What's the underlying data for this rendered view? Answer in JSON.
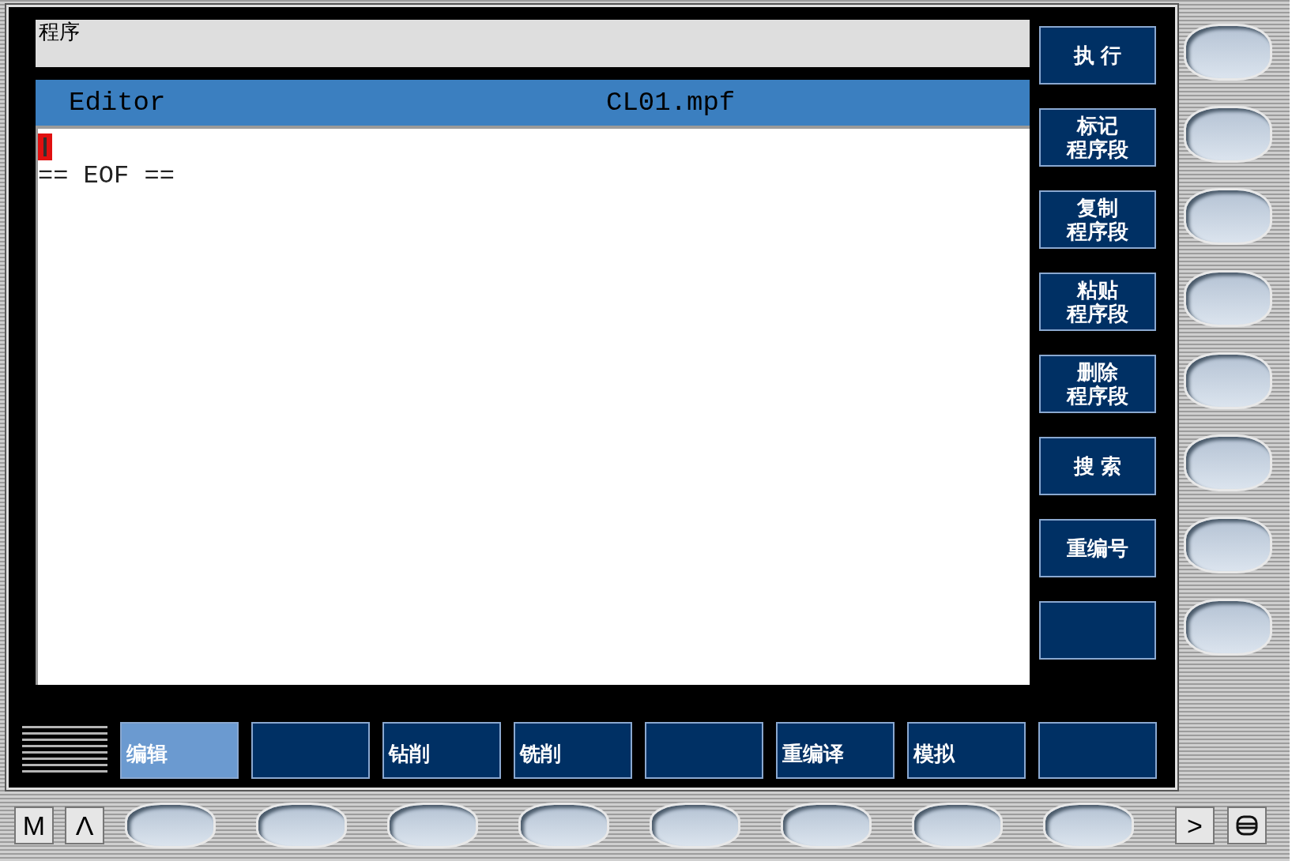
{
  "header": {
    "title": "程序"
  },
  "editor": {
    "mode": "Editor",
    "file": "CL01.mpf",
    "lines": [
      "== EOF =="
    ]
  },
  "vertical_softkeys": [
    {
      "kind": "label",
      "lines": [
        "执 行"
      ]
    },
    {
      "kind": "label",
      "lines": [
        "标记",
        "程序段"
      ]
    },
    {
      "kind": "label",
      "lines": [
        "复制",
        "程序段"
      ]
    },
    {
      "kind": "label",
      "lines": [
        "粘贴",
        "程序段"
      ]
    },
    {
      "kind": "label",
      "lines": [
        "删除",
        "程序段"
      ]
    },
    {
      "kind": "label",
      "lines": [
        "搜 索"
      ]
    },
    {
      "kind": "label",
      "lines": [
        "重编号"
      ]
    },
    {
      "kind": "blank"
    }
  ],
  "horizontal_softkeys": [
    {
      "kind": "label",
      "label": "编辑",
      "selected": true
    },
    {
      "kind": "blank",
      "selected": false
    },
    {
      "kind": "label",
      "label": "钻削",
      "selected": false
    },
    {
      "kind": "label",
      "label": "铣削",
      "selected": false
    },
    {
      "kind": "blank",
      "selected": false
    },
    {
      "kind": "label",
      "label": "重编译",
      "selected": false
    },
    {
      "kind": "label",
      "label": "模拟",
      "selected": false
    },
    {
      "kind": "blank",
      "selected": false
    }
  ],
  "panel_keys": {
    "left": [
      "M",
      "Λ"
    ],
    "right": [
      ">"
    ]
  }
}
